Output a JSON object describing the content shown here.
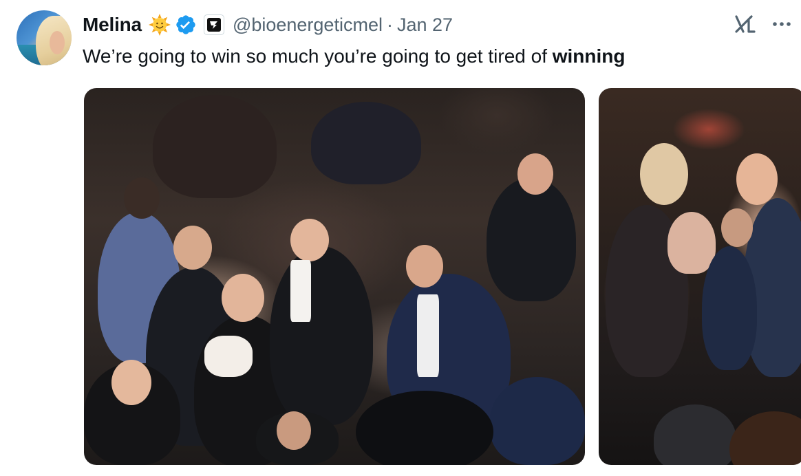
{
  "tweet": {
    "display_name": "Melina",
    "handle": "@bioenergeticmel",
    "separator": "·",
    "date": "Jan 27",
    "text_regular": "We’re going to win so much you’re going to get tired of ",
    "text_bold": "winning"
  },
  "icons": {
    "status_emoji": "sun-face-emoji",
    "verified": "verified-badge-icon",
    "affiliate": "affiliate-badge-icon",
    "grok": "grok-icon",
    "more": "more-options-icon"
  },
  "media": {
    "photo_count": 2
  },
  "colors": {
    "text_primary": "#0f1419",
    "text_secondary": "#536471",
    "verified_blue": "#1d9bf0",
    "sun_yellow": "#f7b500"
  }
}
